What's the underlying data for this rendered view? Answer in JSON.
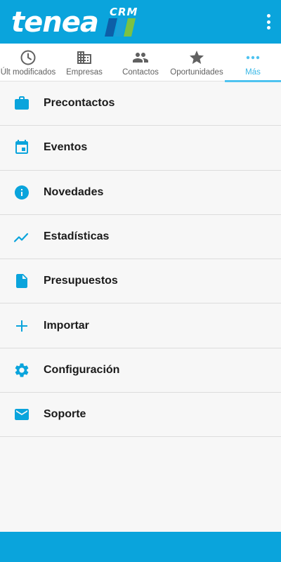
{
  "app": {
    "logo_text": "tenea",
    "logo_sub": "CRM",
    "brand_color": "#0aa4dc",
    "accent_color": "#4fc3f0",
    "overflow_icon": "more-vert-icon"
  },
  "tabs": [
    {
      "label": "Últ modificados",
      "icon": "clock-icon",
      "active": false
    },
    {
      "label": "Empresas",
      "icon": "building-icon",
      "active": false
    },
    {
      "label": "Contactos",
      "icon": "people-icon",
      "active": false
    },
    {
      "label": "Oportunidades",
      "icon": "star-icon",
      "active": false
    },
    {
      "label": "Más",
      "icon": "more-horiz-icon",
      "active": true
    }
  ],
  "menu": [
    {
      "label": "Precontactos",
      "icon": "briefcase-icon"
    },
    {
      "label": "Eventos",
      "icon": "calendar-icon"
    },
    {
      "label": "Novedades",
      "icon": "info-icon"
    },
    {
      "label": "Estadísticas",
      "icon": "trending-icon"
    },
    {
      "label": "Presupuestos",
      "icon": "document-icon"
    },
    {
      "label": "Importar",
      "icon": "plus-icon"
    },
    {
      "label": "Configuración",
      "icon": "gear-icon"
    },
    {
      "label": "Soporte",
      "icon": "mail-icon"
    }
  ]
}
